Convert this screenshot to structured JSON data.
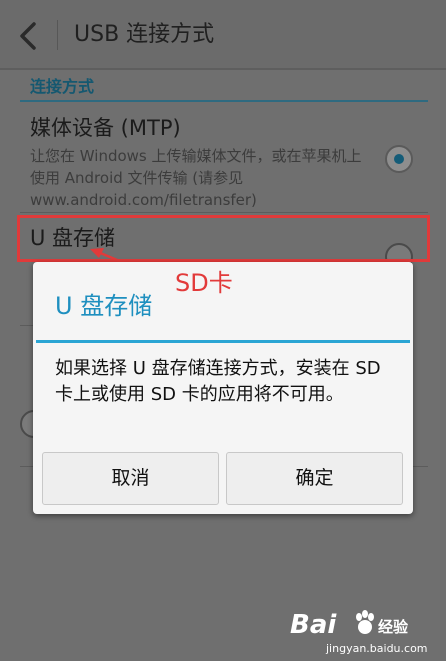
{
  "header": {
    "title": "USB 连接方式",
    "back_icon": "chevron-left-icon"
  },
  "section": {
    "header": "连接方式"
  },
  "options": [
    {
      "title": "媒体设备 (MTP)",
      "description": "让您在 Windows 上传输媒体文件，或在苹果机上使用 Android 文件传输 (请参见 www.android.com/filetransfer)",
      "selected": true
    },
    {
      "title": "U 盘存储",
      "selected": false
    }
  ],
  "annotation": {
    "label": "SD卡",
    "color": "#e23a3a"
  },
  "dialog": {
    "title": "U 盘存储",
    "message": "如果选择 U 盘存储连接方式，安装在 SD 卡上或使用 SD 卡的应用将不可用。",
    "cancel_label": "取消",
    "ok_label": "确定",
    "accent_color": "#2ba5d4"
  },
  "watermark": {
    "brand": "Bai",
    "brand_suffix": "经验",
    "url": "jingyan.baidu.com"
  }
}
